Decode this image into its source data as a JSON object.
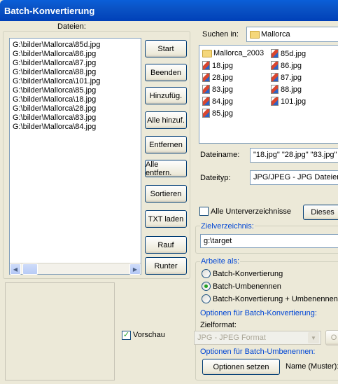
{
  "window": {
    "title": "Batch-Konvertierung"
  },
  "left": {
    "files_label": "Dateien:",
    "files": [
      "G:\\bilder\\Mallorca\\85d.jpg",
      "G:\\bilder\\Mallorca\\86.jpg",
      "G:\\bilder\\Mallorca\\87.jpg",
      "G:\\bilder\\Mallorca\\88.jpg",
      "G:\\bilder\\Mallorca\\101.jpg",
      "G:\\bilder\\Mallorca\\85.jpg",
      "G:\\bilder\\Mallorca\\18.jpg",
      "G:\\bilder\\Mallorca\\28.jpg",
      "G:\\bilder\\Mallorca\\83.jpg",
      "G:\\bilder\\Mallorca\\84.jpg"
    ],
    "buttons": {
      "start": "Start",
      "beenden": "Beenden",
      "hinzufueg": "Hinzufüg.",
      "alle_hinzuf": "Alle hinzuf.",
      "entfernen": "Entfernen",
      "alle_entfern": "Alle entfern.",
      "sortieren": "Sortieren",
      "txt_laden": "TXT laden",
      "rauf": "Rauf",
      "runter": "Runter"
    },
    "preview_label": "Vorschau",
    "preview_checked": true
  },
  "browser": {
    "search_label": "Suchen in:",
    "search_value": "Mallorca",
    "items_col1": [
      {
        "name": "Mallorca_2003",
        "kind": "folder"
      },
      {
        "name": "18.jpg",
        "kind": "jpg"
      },
      {
        "name": "28.jpg",
        "kind": "jpg"
      },
      {
        "name": "83.jpg",
        "kind": "jpg"
      },
      {
        "name": "84.jpg",
        "kind": "jpg"
      },
      {
        "name": "85.jpg",
        "kind": "jpg"
      }
    ],
    "items_col2": [
      {
        "name": "85d.jpg",
        "kind": "jpg"
      },
      {
        "name": "86.jpg",
        "kind": "jpg"
      },
      {
        "name": "87.jpg",
        "kind": "jpg"
      },
      {
        "name": "88.jpg",
        "kind": "jpg"
      },
      {
        "name": "101.jpg",
        "kind": "jpg"
      }
    ],
    "filename_label": "Dateiname:",
    "filename_value": "\"18.jpg\" \"28.jpg\" \"83.jpg\"",
    "filetype_label": "Dateityp:",
    "filetype_value": "JPG/JPEG - JPG Dateien",
    "subdirs_label": "Alle Unterverzeichnisse",
    "subdirs_checked": false,
    "dieses_button": "Dieses"
  },
  "target": {
    "label": "Zielverzeichnis:",
    "value": "g:\\target"
  },
  "work": {
    "label": "Arbeite als:",
    "options": [
      "Batch-Konvertierung",
      "Batch-Umbenennen",
      "Batch-Konvertierung + Umbenennen"
    ],
    "selected": "Batch-Umbenennen",
    "conv_options_label": "Optionen für Batch-Konvertierung:",
    "zielformat_label": "Zielformat:",
    "zielformat_value": "JPG - JPEG Format",
    "zielformat_extra_button": "O",
    "rename_options_label": "Optionen für Batch-Umbenennen:",
    "set_options_button": "Optionen setzen",
    "name_pattern_label": "Name (Muster):"
  }
}
